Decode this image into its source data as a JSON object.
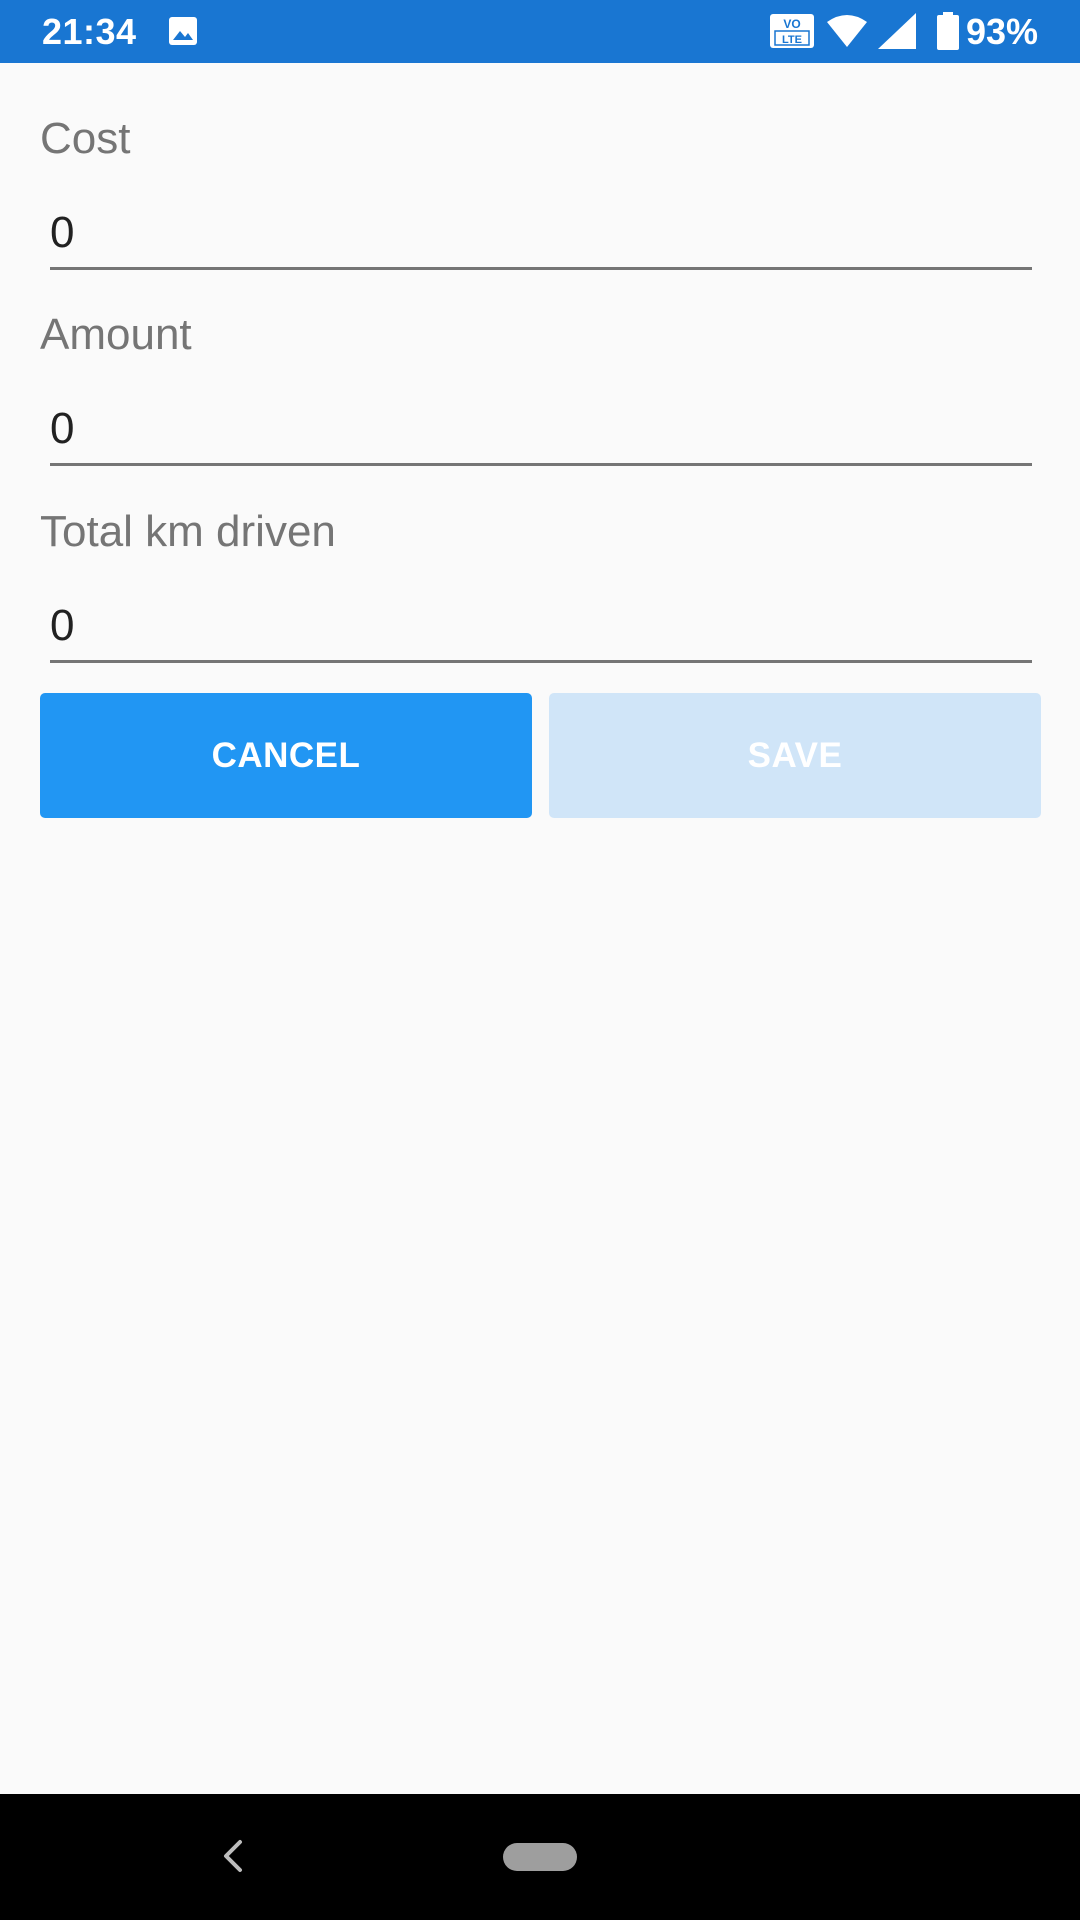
{
  "status_bar": {
    "time": "21:34",
    "battery_percent": "93%",
    "network_badge_top": "VO",
    "network_badge_bottom": "LTE",
    "icons": [
      "image-notification-icon",
      "volte-icon",
      "wifi-icon",
      "cell-signal-icon",
      "battery-icon"
    ],
    "background_color": "#1976D2"
  },
  "form": {
    "fields": [
      {
        "label": "Cost",
        "value": "0"
      },
      {
        "label": "Amount",
        "value": "0"
      },
      {
        "label": "Total km driven",
        "value": "0"
      }
    ],
    "cancel_label": "CANCEL",
    "save_label": "SAVE",
    "save_enabled": false,
    "accent_color": "#2196F3",
    "disabled_button_color": "#D0E5F8"
  },
  "nav_bar": {
    "icons": [
      "back-icon",
      "home-pill-icon"
    ]
  }
}
